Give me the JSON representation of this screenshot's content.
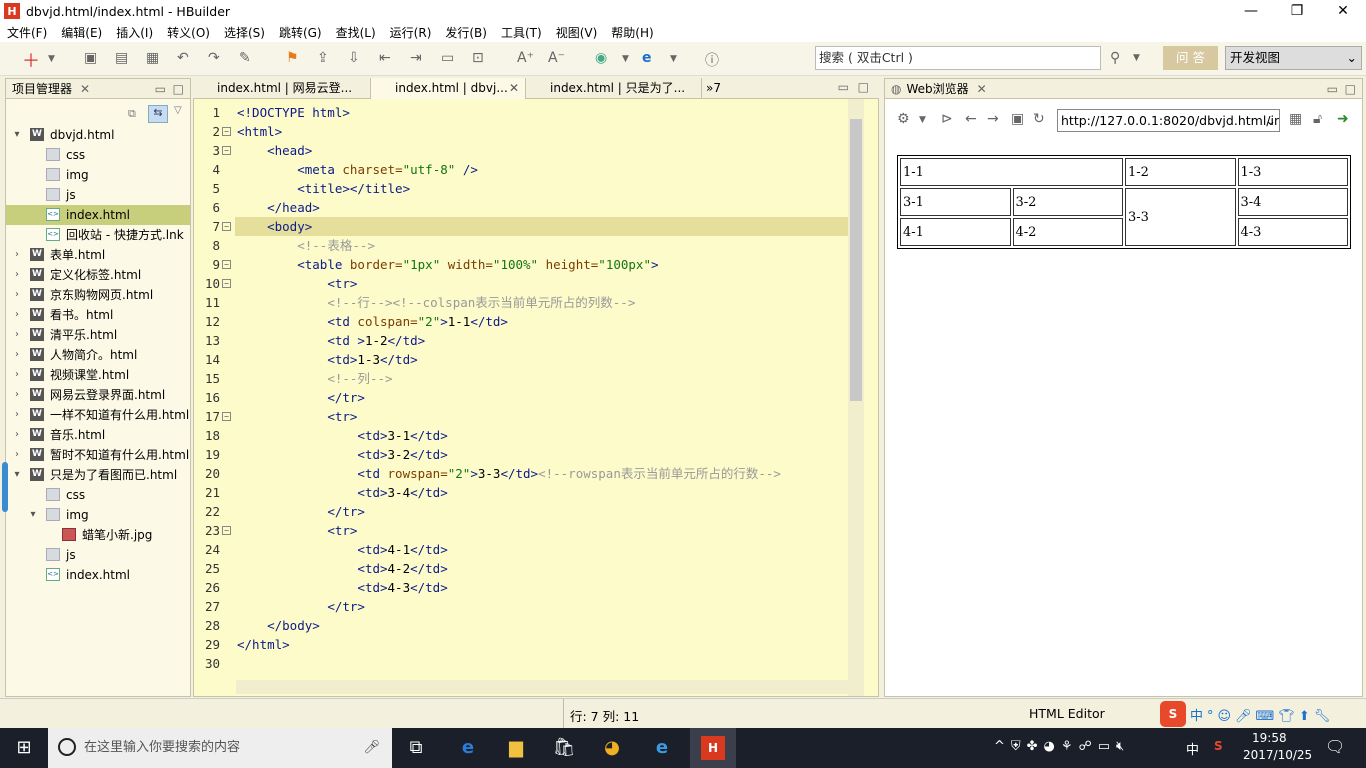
{
  "window": {
    "title": "dbvjd.html/index.html  -  HBuilder",
    "min": "—",
    "max": "❐",
    "close": "✕"
  },
  "menu": [
    "文件(F)",
    "编辑(E)",
    "插入(I)",
    "转义(O)",
    "选择(S)",
    "跳转(G)",
    "查找(L)",
    "运行(R)",
    "发行(B)",
    "工具(T)",
    "视图(V)",
    "帮助(H)"
  ],
  "toolbar": {
    "search_placeholder": "搜索 ( 双击Ctrl )",
    "ask": "问 答",
    "view": "开发视图"
  },
  "project": {
    "title": "项目管理器",
    "items": [
      {
        "label": "dbvjd.html",
        "type": "w",
        "depth": 0,
        "arrow": "▾"
      },
      {
        "label": "css",
        "type": "f",
        "depth": 1,
        "arrow": ""
      },
      {
        "label": "img",
        "type": "f",
        "depth": 1,
        "arrow": ""
      },
      {
        "label": "js",
        "type": "f",
        "depth": 1,
        "arrow": ""
      },
      {
        "label": "index.html",
        "type": "h",
        "depth": 1,
        "arrow": "",
        "sel": true
      },
      {
        "label": "回收站 - 快捷方式.lnk",
        "type": "h",
        "depth": 1,
        "arrow": ""
      },
      {
        "label": "表单.html",
        "type": "w",
        "depth": 0,
        "arrow": "›"
      },
      {
        "label": "定义化标签.html",
        "type": "w",
        "depth": 0,
        "arrow": "›"
      },
      {
        "label": "京东购物网页.html",
        "type": "w",
        "depth": 0,
        "arrow": "›"
      },
      {
        "label": "看书。html",
        "type": "w",
        "depth": 0,
        "arrow": "›"
      },
      {
        "label": "清平乐.html",
        "type": "w",
        "depth": 0,
        "arrow": "›"
      },
      {
        "label": "人物简介。html",
        "type": "w",
        "depth": 0,
        "arrow": "›"
      },
      {
        "label": "视频课堂.html",
        "type": "w",
        "depth": 0,
        "arrow": "›"
      },
      {
        "label": "网易云登录界面.html",
        "type": "w",
        "depth": 0,
        "arrow": "›"
      },
      {
        "label": "一样不知道有什么用.html",
        "type": "w",
        "depth": 0,
        "arrow": "›"
      },
      {
        "label": "音乐.html",
        "type": "w",
        "depth": 0,
        "arrow": "›"
      },
      {
        "label": "暂时不知道有什么用.html",
        "type": "w",
        "depth": 0,
        "arrow": "›"
      },
      {
        "label": "只是为了看图而已.html",
        "type": "w",
        "depth": 0,
        "arrow": "▾"
      },
      {
        "label": "css",
        "type": "f",
        "depth": 1,
        "arrow": ""
      },
      {
        "label": "img",
        "type": "f",
        "depth": 1,
        "arrow": "▾"
      },
      {
        "label": "蜡笔小新.jpg",
        "type": "j",
        "depth": 2,
        "arrow": ""
      },
      {
        "label": "js",
        "type": "f",
        "depth": 1,
        "arrow": ""
      },
      {
        "label": "index.html",
        "type": "h",
        "depth": 1,
        "arrow": ""
      }
    ]
  },
  "tabs": [
    {
      "label": "index.html | 网易云登..."
    },
    {
      "label": "index.html | dbvj..."
    },
    {
      "label": "index.html | 只是为了..."
    },
    {
      "label": "»7"
    }
  ],
  "editor": {
    "line_numbers": [
      "1",
      "2",
      "3",
      "4",
      "5",
      "6",
      "7",
      "8",
      "9",
      "10",
      "11",
      "12",
      "13",
      "14",
      "15",
      "16",
      "17",
      "18",
      "19",
      "20",
      "21",
      "22",
      "23",
      "24",
      "25",
      "26",
      "27",
      "28",
      "29",
      "30"
    ],
    "folds": [
      "2",
      "3",
      "7",
      "9",
      "10",
      "17",
      "23"
    ],
    "current_line": "7"
  },
  "browser": {
    "title": "Web浏览器",
    "url": "http://127.0.0.1:8020/dbvjd.html/in",
    "cells": {
      "r1c1": "1-1",
      "r1c2": "1-2",
      "r1c3": "1-3",
      "r2c1": "3-1",
      "r2c2": "3-2",
      "r2c3": "3-3",
      "r2c4": "3-4",
      "r3c1": "4-1",
      "r3c2": "4-2",
      "r3c3": "4-3"
    }
  },
  "status": {
    "position": "行: 7 列: 11",
    "mode": "HTML Editor"
  },
  "taskbar": {
    "search": "在这里输入你要搜索的内容",
    "time": "19:58",
    "date": "2017/10/25",
    "ime": "中"
  }
}
